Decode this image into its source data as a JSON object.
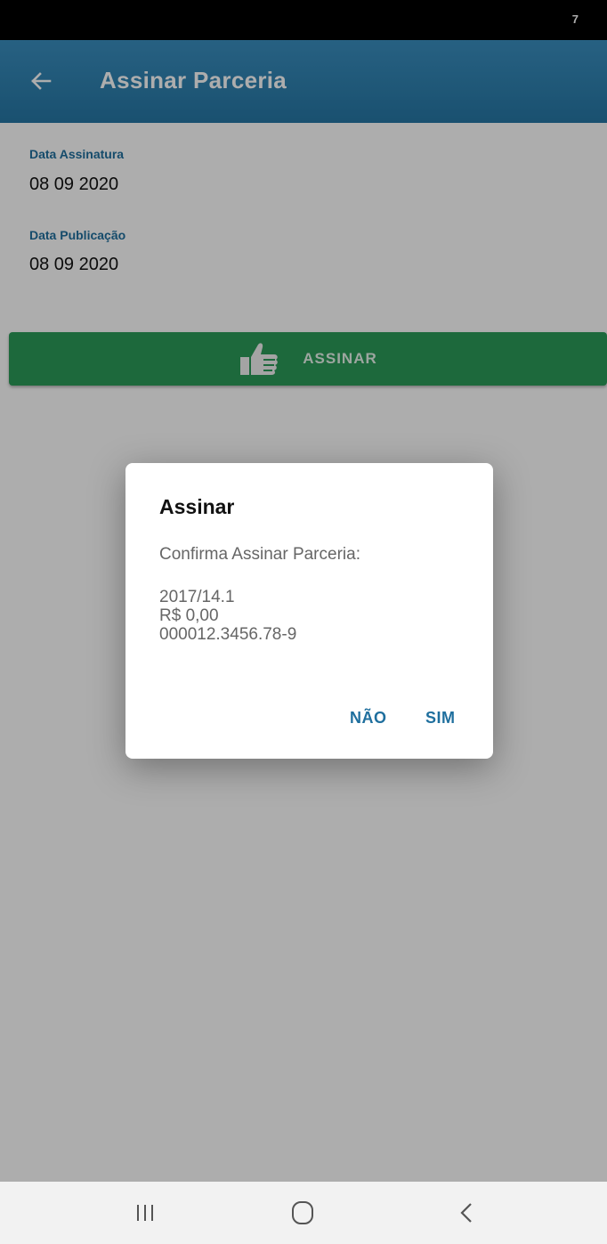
{
  "status_bar": {
    "indicator": "7"
  },
  "app_bar": {
    "title": "Assinar Parceria"
  },
  "fields": [
    {
      "label": "Data Assinatura",
      "value": "08 09 2020"
    },
    {
      "label": "Data Publicação",
      "value": "08 09 2020"
    }
  ],
  "sign_button": {
    "label": "ASSINAR"
  },
  "dialog": {
    "title": "Assinar",
    "message": "Confirma Assinar Parceria:",
    "details": [
      "2017/14.1",
      "R$ 0,00",
      "000012.3456.78-9"
    ],
    "no_label": "NÃO",
    "yes_label": "SIM"
  },
  "colors": {
    "app_bar": "#2677a5",
    "accent_text": "#1f6f9e",
    "button_green": "#2c9b59",
    "scrim": "rgba(0,0,0,0.32)"
  },
  "icons": {
    "back": "arrow-left-icon",
    "thumb": "thumbs-up-icon",
    "nav_recents": "recents-icon",
    "nav_home": "home-icon",
    "nav_back": "chevron-left-icon"
  }
}
